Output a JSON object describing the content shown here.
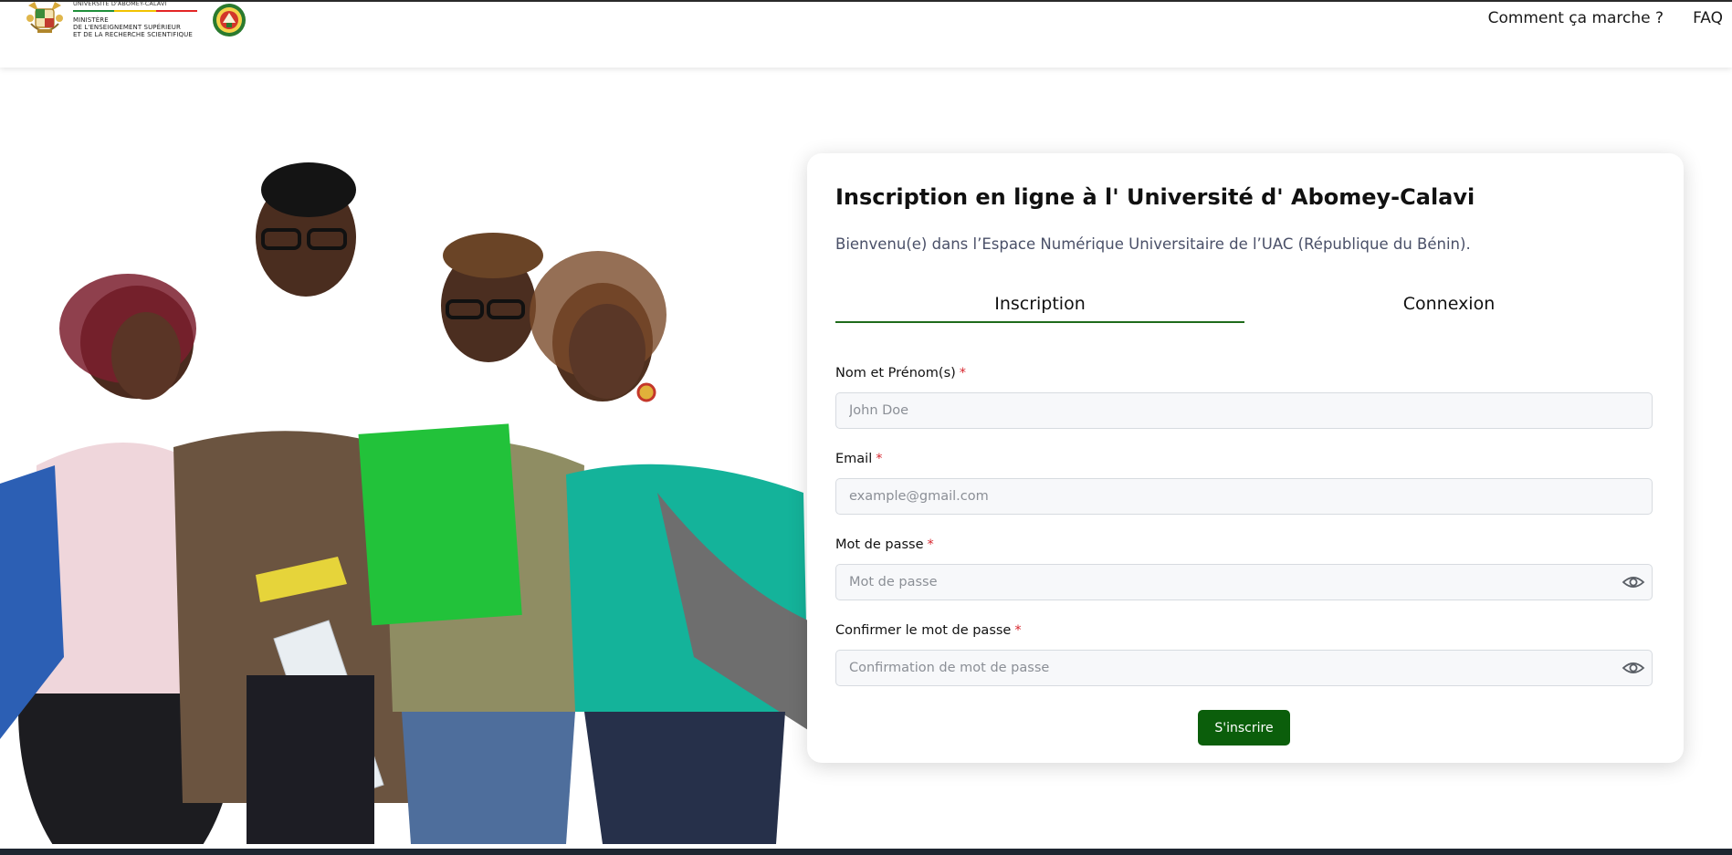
{
  "header": {
    "logo": {
      "university": "UNIVERSITÉ D'ABOMEY-CALAVI",
      "ministry_line1": "MINISTÈRE",
      "ministry_line2": "DE L'ENSEIGNEMENT SUPÉRIEUR",
      "ministry_line3": "ET DE LA RECHERCHE SCIENTIFIQUE",
      "flag_colors": [
        "#1f8f3a",
        "#f2c200",
        "#e32525"
      ]
    },
    "nav": [
      {
        "label": "Comment ça marche ?"
      },
      {
        "label": "FAQ"
      }
    ]
  },
  "form": {
    "title": "Inscription en ligne à l' Université d' Abomey-Calavi",
    "subtitle": "Bienvenu(e) dans l’Espace Numérique Universitaire de l’UAC (République du Bénin).",
    "tabs": [
      {
        "label": "Inscription",
        "active": true
      },
      {
        "label": "Connexion",
        "active": false
      }
    ],
    "fields": {
      "name": {
        "label": "Nom et Prénom(s)",
        "required": "*",
        "placeholder": "John Doe",
        "value": ""
      },
      "email": {
        "label": "Email",
        "required": "*",
        "placeholder": "example@gmail.com",
        "value": ""
      },
      "password": {
        "label": "Mot de passe",
        "required": "*",
        "placeholder": "Mot de passe",
        "value": ""
      },
      "confirm": {
        "label": "Confirmer le mot de passe",
        "required": "*",
        "placeholder": "Confirmation de mot de passe",
        "value": ""
      }
    },
    "submit_label": "S'inscrire"
  },
  "colors": {
    "accent_green": "#0b5e0b",
    "tab_underline": "#1f6b1b",
    "required_red": "#d7262e",
    "subtitle_text": "#4a5068"
  }
}
